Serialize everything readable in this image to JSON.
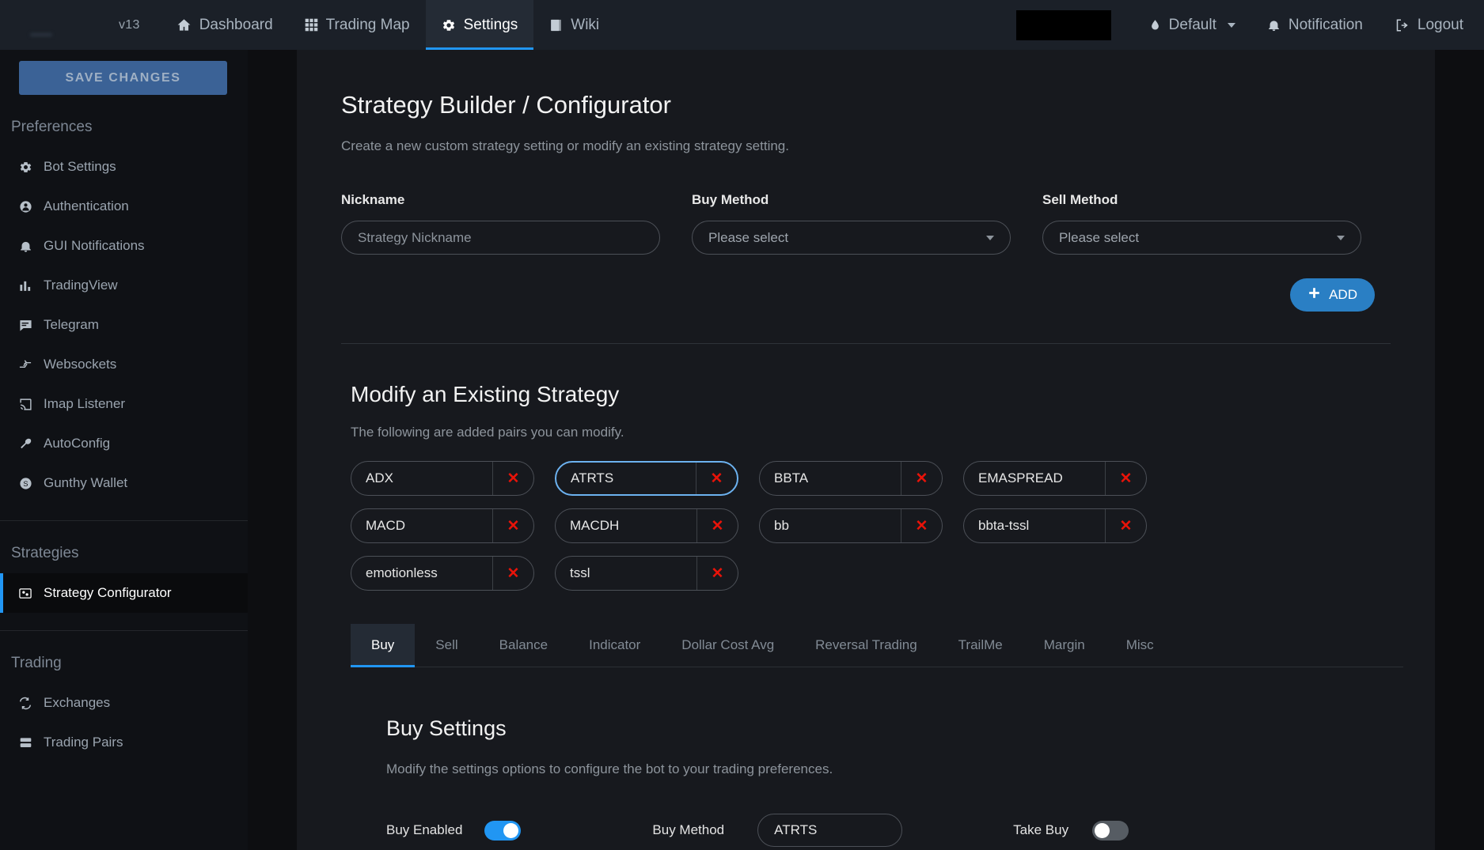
{
  "topnav": {
    "version": "v13",
    "items": [
      {
        "label": "Dashboard",
        "icon": "home-icon",
        "active": false
      },
      {
        "label": "Trading Map",
        "icon": "grid-icon",
        "active": false
      },
      {
        "label": "Settings",
        "icon": "gear-icon",
        "active": true
      },
      {
        "label": "Wiki",
        "icon": "book-icon",
        "active": false
      }
    ],
    "redacted_field": "",
    "theme": {
      "label": "Default",
      "icon": "droplet-icon"
    },
    "notification": {
      "label": "Notification",
      "icon": "bell-icon"
    },
    "logout": {
      "label": "Logout",
      "icon": "logout-icon"
    }
  },
  "sidebar": {
    "save_label": "SAVE CHANGES",
    "groups": [
      {
        "title": "Preferences",
        "items": [
          {
            "label": "Bot Settings",
            "icon": "gear-icon",
            "active": false
          },
          {
            "label": "Authentication",
            "icon": "user-circle-icon",
            "active": false
          },
          {
            "label": "GUI Notifications",
            "icon": "bell-icon",
            "active": false
          },
          {
            "label": "TradingView",
            "icon": "bar-chart-icon",
            "active": false
          },
          {
            "label": "Telegram",
            "icon": "message-icon",
            "active": false
          },
          {
            "label": "Websockets",
            "icon": "arrows-icon",
            "active": false
          },
          {
            "label": "Imap Listener",
            "icon": "cast-icon",
            "active": false
          },
          {
            "label": "AutoConfig",
            "icon": "wrench-icon",
            "active": false
          },
          {
            "label": "Gunthy Wallet",
            "icon": "dollar-circle-icon",
            "active": false
          }
        ]
      },
      {
        "title": "Strategies",
        "items": [
          {
            "label": "Strategy Configurator",
            "icon": "configurator-icon",
            "active": true
          }
        ]
      },
      {
        "title": "Trading",
        "items": [
          {
            "label": "Exchanges",
            "icon": "exchange-icon",
            "active": false
          },
          {
            "label": "Trading Pairs",
            "icon": "pairs-icon",
            "active": false
          }
        ]
      }
    ]
  },
  "page": {
    "title": "Strategy Builder / Configurator",
    "subtitle": "Create a new custom strategy setting or modify an existing strategy setting.",
    "form": {
      "nickname": {
        "label": "Nickname",
        "value": "",
        "placeholder": "Strategy Nickname"
      },
      "buy_method": {
        "label": "Buy Method",
        "value": "Please select"
      },
      "sell_method": {
        "label": "Sell Method",
        "value": "Please select"
      },
      "add_label": "ADD"
    },
    "modify": {
      "title": "Modify an Existing Strategy",
      "subtitle": "The following are added pairs you can modify.",
      "remove_glyph": "✕",
      "chips": [
        {
          "label": "ADX",
          "selected": false
        },
        {
          "label": "ATRTS",
          "selected": true
        },
        {
          "label": "BBTA",
          "selected": false
        },
        {
          "label": "EMASPREAD",
          "selected": false
        },
        {
          "label": "MACD",
          "selected": false
        },
        {
          "label": "MACDH",
          "selected": false
        },
        {
          "label": "bb",
          "selected": false
        },
        {
          "label": "bbta-tssl",
          "selected": false
        },
        {
          "label": "emotionless",
          "selected": false
        },
        {
          "label": "tssl",
          "selected": false
        }
      ]
    },
    "tabs": [
      {
        "label": "Buy",
        "active": true
      },
      {
        "label": "Sell",
        "active": false
      },
      {
        "label": "Balance",
        "active": false
      },
      {
        "label": "Indicator",
        "active": false
      },
      {
        "label": "Dollar Cost Avg",
        "active": false
      },
      {
        "label": "Reversal Trading",
        "active": false
      },
      {
        "label": "TrailMe",
        "active": false
      },
      {
        "label": "Margin",
        "active": false
      },
      {
        "label": "Misc",
        "active": false
      }
    ],
    "buy_settings": {
      "title": "Buy Settings",
      "subtitle": "Modify the settings options to configure the bot to your trading preferences.",
      "buy_enabled": {
        "label": "Buy Enabled",
        "state": "on"
      },
      "buy_method": {
        "label": "Buy Method",
        "value": "ATRTS"
      },
      "take_buy": {
        "label": "Take Buy",
        "state": "off"
      }
    }
  },
  "colors": {
    "accent": "#2196f3",
    "nav_bg": "#1b2028",
    "card_bg": "#17191e",
    "page_bg": "#0d0e11",
    "sidebar_bg": "#0f1115",
    "danger": "#e81309",
    "save_btn": "#3b6296"
  }
}
